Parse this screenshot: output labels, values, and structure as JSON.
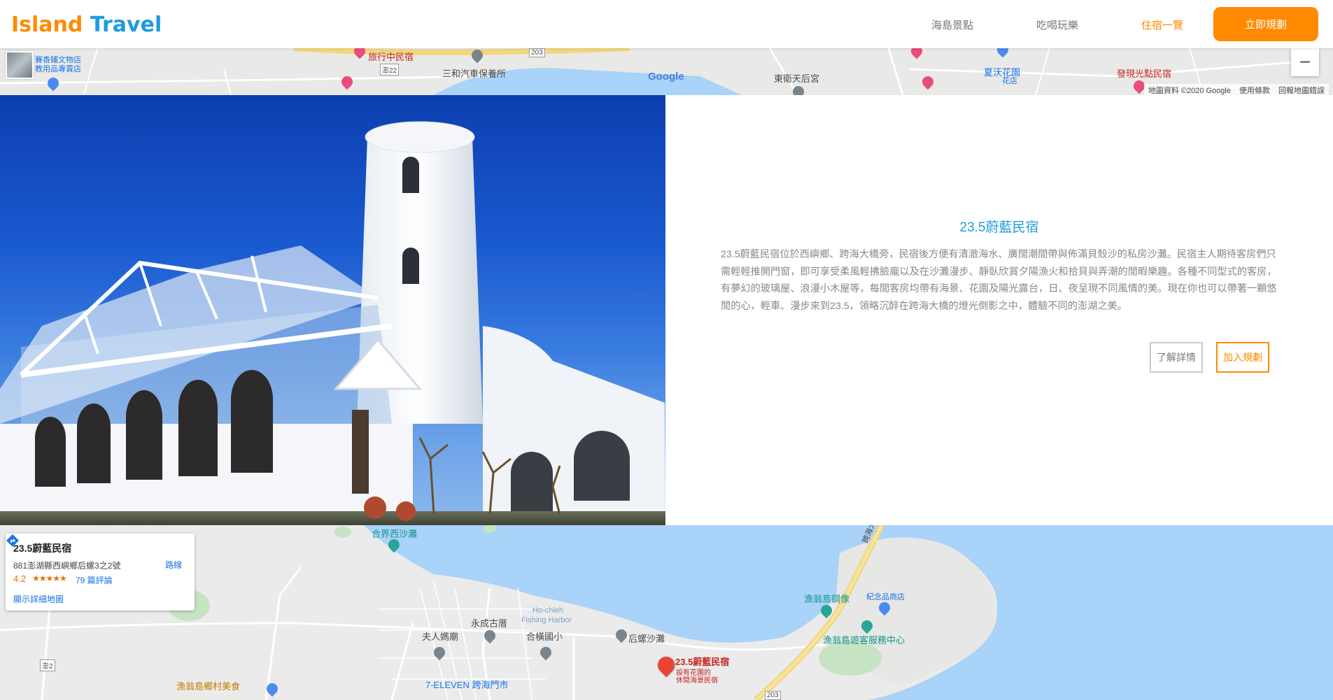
{
  "nav": {
    "logo_part1": "Island",
    "logo_part2": " Travel",
    "links": [
      "海島景點",
      "吃喝玩樂",
      "住宿一覽"
    ],
    "cta": "立即規劃",
    "brand_orange": "#ff8a00",
    "brand_blue": "#1e9be0"
  },
  "map_top": {
    "labels": {
      "shop_name": "賽香鋪文物店",
      "shop_sub": "教用品專賣店",
      "inn": "旅行中民宿",
      "road_label": "澎22",
      "car_shop": "三和汽車保養所",
      "road2": "203",
      "google": "Google",
      "temple": "東衛天后宮",
      "garden": "夏沃花園",
      "garden_sub": "花店",
      "inn2": "發現光點民宿"
    },
    "zoom_out": "−",
    "attribution": [
      "地圖資料 ©2020 Google",
      "使用條款",
      "回報地圖錯誤"
    ]
  },
  "detail": {
    "title": "23.5蔚藍民宿",
    "description": "23.5蔚藍民宿位於西嶼鄉、跨海大橋旁，民宿後方便有清澈海水、廣闊潮間帶與佈滿貝殼沙的私房沙灘。民宿主人期待客房們只需輕輕推開門窗，即可享受柔風輕拂臉龐以及在沙灘漫步、靜臥欣賞夕陽漁火和拾貝與弄潮的閒暇樂趣。各種不同型式的客房，有夢幻的玻璃屋、浪漫小木屋等，每間客房均帶有海景、花園及陽光露台，日、夜呈現不同風情的美。現在你也可以帶著一顆悠閒的心，輕車、漫步來到23.5，領略沉醉在跨海大橋的燈光倒影之中，體驗不同的澎湖之美。",
    "btn_more": "了解詳情",
    "btn_add": "加入規劃"
  },
  "map_bottom": {
    "card": {
      "name": "23.5蔚藍民宿",
      "address": "881澎湖縣西嶼鄉后螺3之2號",
      "rating": "4.2",
      "stars": "★★★★★",
      "reviews": "79 篇評論",
      "directions": "路線",
      "view_larger": "顯示詳細地圖"
    },
    "labels": {
      "beach_west": "合界西沙灘",
      "bridge": "跨海大橋",
      "statue": "漁翁島鋼像",
      "souvenir": "紀念品商店",
      "yongcheng": "永成古厝",
      "harbor_en1": "Ho-chieh",
      "harbor_en2": "Fishing Harbor",
      "mazu": "夫人媽廟",
      "school": "合橫國小",
      "back_beach": "后螺沙灘",
      "visitor_center": "漁翁島遊客服務中心",
      "marker_name": "23.5蔚藍民宿",
      "marker_sub1": "設有花園的",
      "marker_sub2": "休閒海景民宿",
      "road": "澎2",
      "seven": "7-ELEVEN 跨海門市",
      "food": "漁翁島鄉村美食",
      "road203": "203"
    }
  }
}
